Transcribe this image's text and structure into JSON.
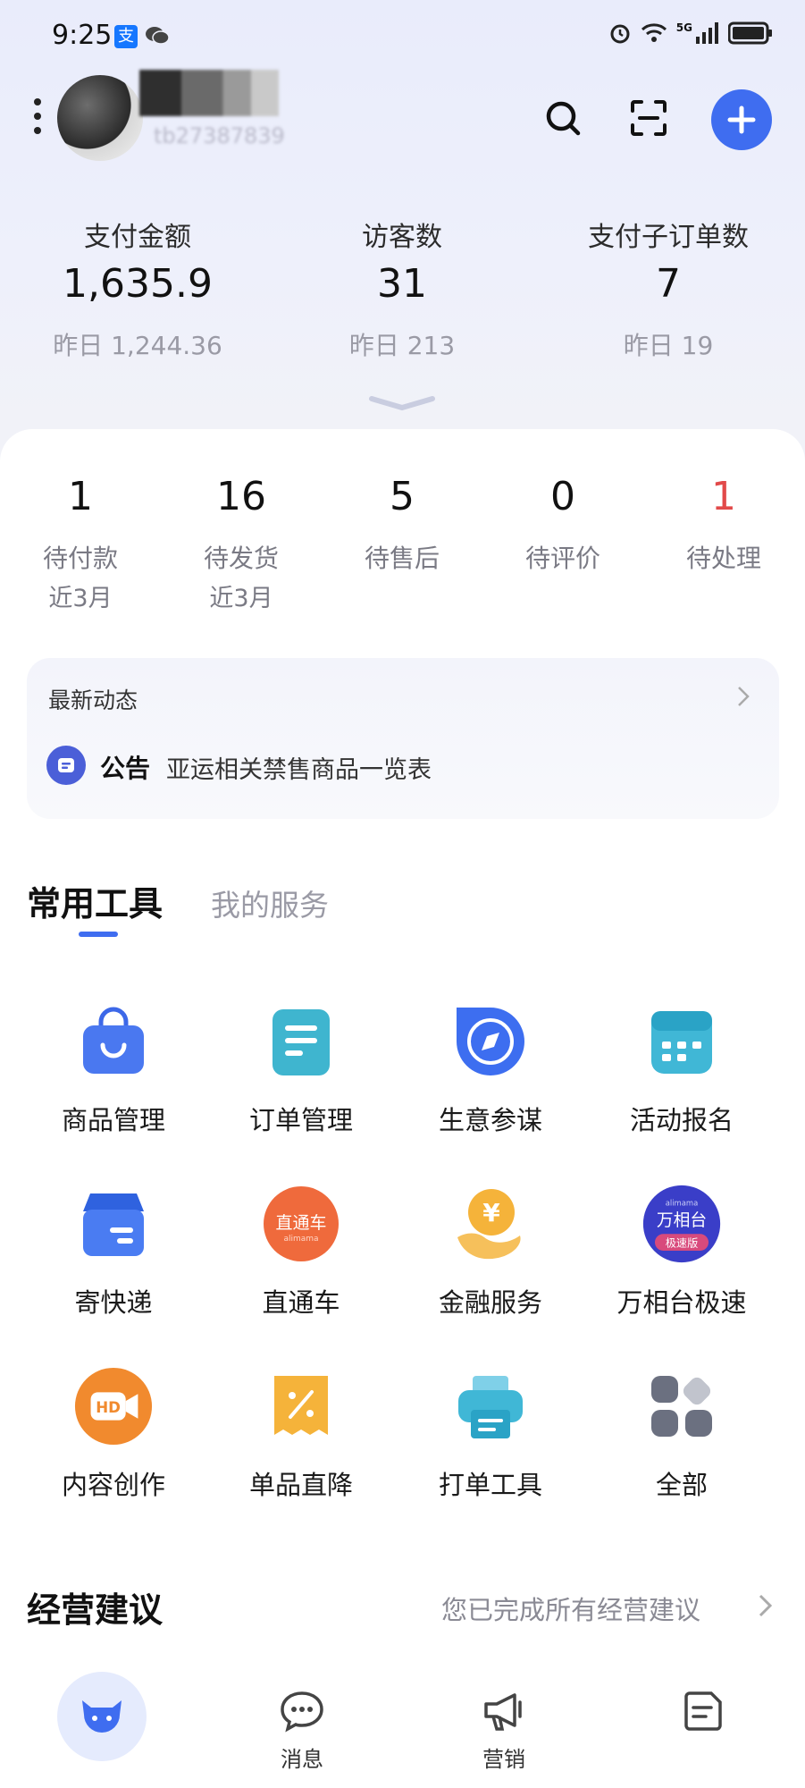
{
  "status_bar": {
    "time": "9:25",
    "alipay_badge": "支",
    "network": "5G"
  },
  "header": {
    "shop_id_text": "tb27387839",
    "search_icon": "search-icon",
    "scan_icon": "scan-icon",
    "add_icon": "plus-icon",
    "accent": "#3f6df0"
  },
  "stats": [
    {
      "label": "支付金额",
      "value": "1,635.9",
      "yesterday": "昨日 1,244.36"
    },
    {
      "label": "访客数",
      "value": "31",
      "yesterday": "昨日 213"
    },
    {
      "label": "支付子订单数",
      "value": "7",
      "yesterday": "昨日 19"
    }
  ],
  "orders": [
    {
      "count": "1",
      "label": "待付款",
      "sub": "近3月"
    },
    {
      "count": "16",
      "label": "待发货",
      "sub": "近3月"
    },
    {
      "count": "5",
      "label": "待售后",
      "sub": ""
    },
    {
      "count": "0",
      "label": "待评价",
      "sub": ""
    },
    {
      "count": "1",
      "label": "待处理",
      "sub": "",
      "highlight": "#e24a4a"
    }
  ],
  "news": {
    "title": "最新动态",
    "tag": "公告",
    "text": "亚运相关禁售商品一览表"
  },
  "tabs": {
    "active": "常用工具",
    "other": "我的服务"
  },
  "tools": [
    {
      "label": "商品管理",
      "icon": "shopping-bag-icon"
    },
    {
      "label": "订单管理",
      "icon": "order-list-icon"
    },
    {
      "label": "生意参谋",
      "icon": "compass-icon"
    },
    {
      "label": "活动报名",
      "icon": "calendar-icon"
    },
    {
      "label": "寄快递",
      "icon": "parcel-box-icon"
    },
    {
      "label": "直通车",
      "icon": "ztc-logo-icon",
      "logo_text": "直通车",
      "logo_sub": "alimama"
    },
    {
      "label": "金融服务",
      "icon": "coin-hand-icon",
      "logo_text": "¥"
    },
    {
      "label": "万相台极速",
      "icon": "wanxiangtai-logo-icon",
      "logo_text": "万相台",
      "logo_badge": "极速版",
      "logo_sub": "alimama"
    },
    {
      "label": "内容创作",
      "icon": "hd-video-icon",
      "logo_text": "HD"
    },
    {
      "label": "单品直降",
      "icon": "coupon-percent-icon"
    },
    {
      "label": "打单工具",
      "icon": "printer-icon"
    },
    {
      "label": "全部",
      "icon": "all-apps-icon"
    }
  ],
  "advice": {
    "title": "经营建议",
    "status": "您已完成所有经营建议"
  },
  "bottom_nav": [
    {
      "label": "",
      "icon": "home-mascot-icon"
    },
    {
      "label": "消息",
      "icon": "message-bubble-icon"
    },
    {
      "label": "营销",
      "icon": "megaphone-icon"
    },
    {
      "label": "",
      "icon": "note-icon"
    }
  ]
}
